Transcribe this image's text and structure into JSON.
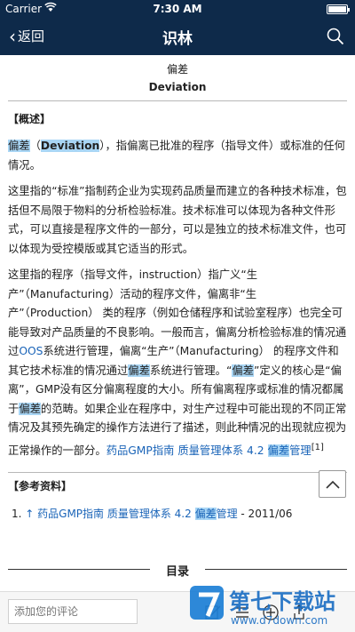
{
  "status_bar": {
    "carrier": "Carrier",
    "time": "7:30 AM"
  },
  "nav": {
    "back_label": "返回",
    "title": "识林"
  },
  "article": {
    "title": "偏差",
    "subtitle": "Deviation",
    "overview_heading": "【概述】",
    "p1": {
      "term": "偏差",
      "paren_open": "（",
      "term_en": "Deviation",
      "rest": "），指偏离已批准的程序（指导文件）或标准的任何情况。"
    },
    "p2": "这里指的“标准”指制药企业为实现药品质量而建立的各种技术标准，包括但不局限于物料的分析检验标准。技术标准可以体现为各种文件形式，可以直接是程序文件的一部分，可以是独立的技术标准文件，也可以体现为受控模版或其它适当的形式。",
    "p3": {
      "s1": "这里指的程序（指导文件，instruction）指广义“生产”（Manufacturing）活动的程序文件，偏离非“生产”（Production） 类的程序（例如仓储程序和试验室程序）也完全可能导致对产品质量的不良影响。一般而言，偏离分析检验标准的情况通过",
      "oos": "OOS",
      "s2": "系统进行管理，偏离“生产”（Manufacturing） 的程序文件和其它技术标准的情况通过",
      "hl1": "偏差",
      "s3": "系统进行管理。“",
      "hl2": "偏差",
      "s4": "”定义的核心是“偏离”，GMP没有区分偏离程度的大小。所有偏离程序或标准的情况都属于",
      "hl3": "偏差",
      "s5": "的范畴。如果企业在程序中，对生产过程中可能出现的不同正常情况及其预先确定的操作方法进行了描述，则此种情况的出现就应视为正常操作的一部分。",
      "link1": "药品GMP指南 质量管理体系 4.2 ",
      "link_hl": "偏差",
      "link2": "管理",
      "sup": "[1]"
    },
    "refs_heading": "【参考资料】",
    "ref1": {
      "num": "1. ",
      "arrow": "↑",
      "text1": " 药品GMP指南 质量管理体系 4.2 ",
      "hl": "偏差",
      "text2": "管理",
      "date": " - 2011/06"
    }
  },
  "toc_label": "目录",
  "comment": {
    "placeholder": "添加您的评论"
  },
  "watermark": {
    "brand": "第七下载站",
    "url": "www.d7down.com"
  },
  "colors": {
    "nav_bg": "#0e2a4a",
    "highlight": "#a9d6f5",
    "link": "#1a64b8"
  }
}
